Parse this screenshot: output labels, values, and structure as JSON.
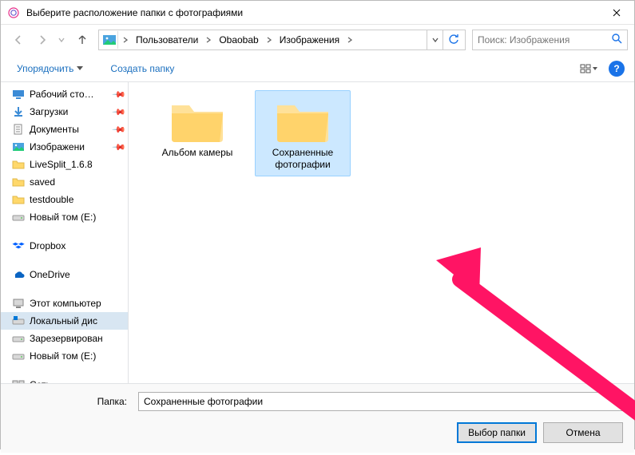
{
  "window": {
    "title": "Выберите расположение папки с фотографиями"
  },
  "breadcrumbs": {
    "items": [
      "Пользователи",
      "Obaobab",
      "Изображения"
    ]
  },
  "search": {
    "placeholder": "Поиск: Изображения"
  },
  "toolbar": {
    "organize": "Упорядочить",
    "newfolder": "Создать папку"
  },
  "tree": {
    "group1": [
      {
        "label": "Рабочий сто…",
        "icon": "desktop",
        "pinned": true
      },
      {
        "label": "Загрузки",
        "icon": "downloads",
        "pinned": true
      },
      {
        "label": "Документы",
        "icon": "documents",
        "pinned": true
      },
      {
        "label": "Изображени",
        "icon": "pictures",
        "pinned": true
      },
      {
        "label": "LiveSplit_1.6.8",
        "icon": "folder"
      },
      {
        "label": "saved",
        "icon": "folder"
      },
      {
        "label": "testdouble",
        "icon": "folder"
      },
      {
        "label": "Новый том (E:)",
        "icon": "drive"
      }
    ],
    "group2": [
      {
        "label": "Dropbox",
        "icon": "dropbox"
      }
    ],
    "group3": [
      {
        "label": "OneDrive",
        "icon": "onedrive"
      }
    ],
    "group4": [
      {
        "label": "Этот компьютер",
        "icon": "thispc"
      },
      {
        "label": "Локальный дис",
        "icon": "osdrive",
        "selected": true
      },
      {
        "label": "Зарезервирован",
        "icon": "drive"
      },
      {
        "label": "Новый том (E:)",
        "icon": "drive"
      }
    ],
    "group5": [
      {
        "label": "Сеть",
        "icon": "network"
      }
    ]
  },
  "content": {
    "folders": [
      {
        "label": "Альбом камеры",
        "selected": false
      },
      {
        "label": "Сохраненные фотографии",
        "selected": true
      }
    ]
  },
  "folder_field": {
    "label": "Папка:",
    "value": "Сохраненные фотографии"
  },
  "buttons": {
    "select": "Выбор папки",
    "cancel": "Отмена"
  }
}
